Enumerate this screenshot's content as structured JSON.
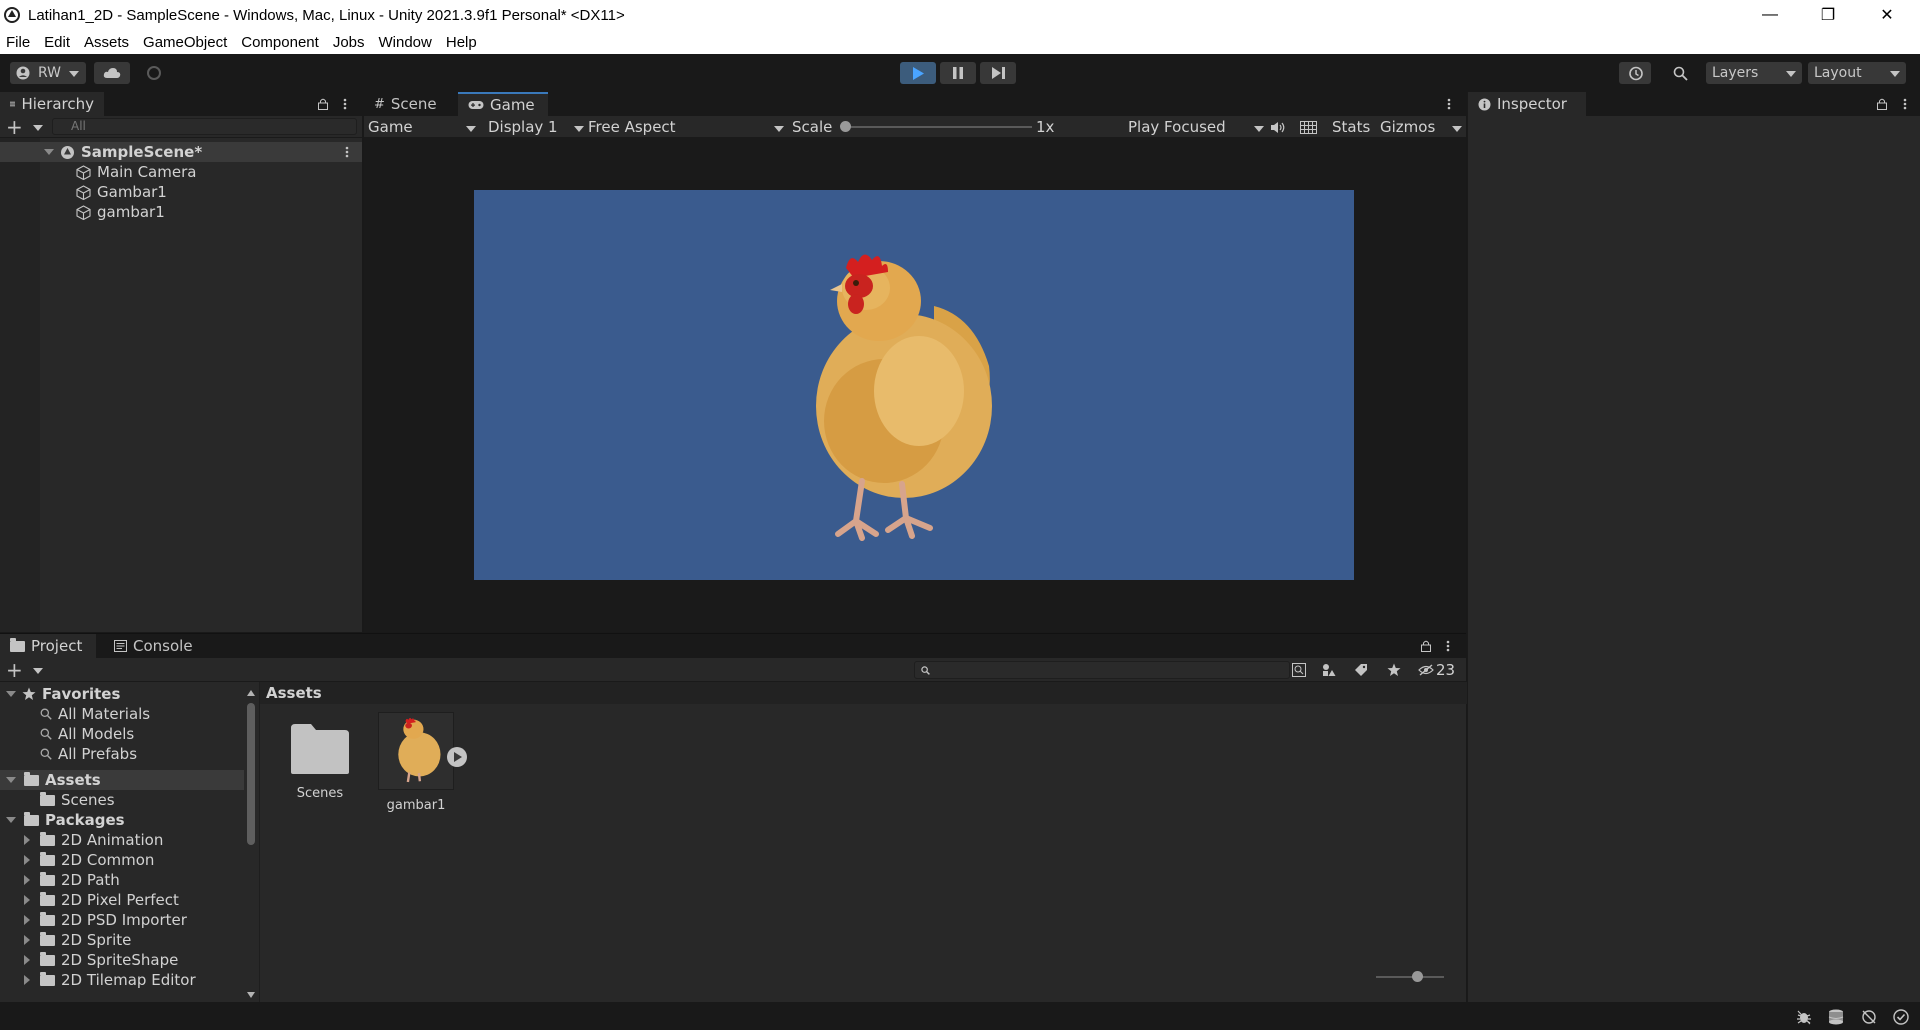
{
  "window": {
    "title": "Latihan1_2D - SampleScene - Windows, Mac, Linux - Unity 2021.3.9f1 Personal* <DX11>",
    "minimize": "—",
    "maximize": "❐",
    "close": "✕"
  },
  "menu": [
    "File",
    "Edit",
    "Assets",
    "GameObject",
    "Component",
    "Jobs",
    "Window",
    "Help"
  ],
  "toolbar": {
    "account": "RW",
    "layers": "Layers",
    "layout": "Layout"
  },
  "hierarchy": {
    "tab": "Hierarchy",
    "search_placeholder": "All",
    "scene": "SampleScene*",
    "objects": [
      "Main Camera",
      "Gambar1",
      "gambar1"
    ]
  },
  "game": {
    "tab_scene": "Scene",
    "tab_game": "Game",
    "mode": "Game",
    "display": "Display 1",
    "aspect": "Free Aspect",
    "scale_label": "Scale",
    "scale_value": "1x",
    "play_mode": "Play Focused",
    "stats": "Stats",
    "gizmos": "Gizmos",
    "background_color": "#3a5b8e"
  },
  "inspector": {
    "tab": "Inspector"
  },
  "project": {
    "tab_project": "Project",
    "tab_console": "Console",
    "hidden_count": "23",
    "favorites": "Favorites",
    "favorite_items": [
      "All Materials",
      "All Models",
      "All Prefabs"
    ],
    "assets": "Assets",
    "asset_children": [
      "Scenes"
    ],
    "packages": "Packages",
    "package_items": [
      "2D Animation",
      "2D Common",
      "2D Path",
      "2D Pixel Perfect",
      "2D PSD Importer",
      "2D Sprite",
      "2D SpriteShape",
      "2D Tilemap Editor"
    ],
    "grid_header": "Assets",
    "grid_items": [
      "Scenes",
      "gambar1"
    ]
  }
}
